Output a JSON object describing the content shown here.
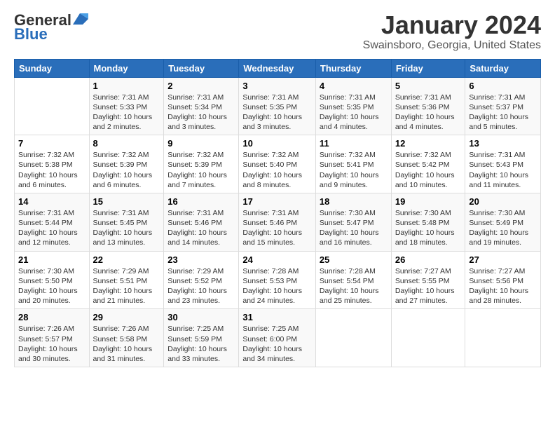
{
  "header": {
    "logo_line1": "General",
    "logo_line2": "Blue",
    "calendar_title": "January 2024",
    "calendar_subtitle": "Swainsboro, Georgia, United States"
  },
  "days_of_week": [
    "Sunday",
    "Monday",
    "Tuesday",
    "Wednesday",
    "Thursday",
    "Friday",
    "Saturday"
  ],
  "weeks": [
    [
      {
        "day": "",
        "info": ""
      },
      {
        "day": "1",
        "info": "Sunrise: 7:31 AM\nSunset: 5:33 PM\nDaylight: 10 hours\nand 2 minutes."
      },
      {
        "day": "2",
        "info": "Sunrise: 7:31 AM\nSunset: 5:34 PM\nDaylight: 10 hours\nand 3 minutes."
      },
      {
        "day": "3",
        "info": "Sunrise: 7:31 AM\nSunset: 5:35 PM\nDaylight: 10 hours\nand 3 minutes."
      },
      {
        "day": "4",
        "info": "Sunrise: 7:31 AM\nSunset: 5:35 PM\nDaylight: 10 hours\nand 4 minutes."
      },
      {
        "day": "5",
        "info": "Sunrise: 7:31 AM\nSunset: 5:36 PM\nDaylight: 10 hours\nand 4 minutes."
      },
      {
        "day": "6",
        "info": "Sunrise: 7:31 AM\nSunset: 5:37 PM\nDaylight: 10 hours\nand 5 minutes."
      }
    ],
    [
      {
        "day": "7",
        "info": "Sunrise: 7:32 AM\nSunset: 5:38 PM\nDaylight: 10 hours\nand 6 minutes."
      },
      {
        "day": "8",
        "info": "Sunrise: 7:32 AM\nSunset: 5:39 PM\nDaylight: 10 hours\nand 6 minutes."
      },
      {
        "day": "9",
        "info": "Sunrise: 7:32 AM\nSunset: 5:39 PM\nDaylight: 10 hours\nand 7 minutes."
      },
      {
        "day": "10",
        "info": "Sunrise: 7:32 AM\nSunset: 5:40 PM\nDaylight: 10 hours\nand 8 minutes."
      },
      {
        "day": "11",
        "info": "Sunrise: 7:32 AM\nSunset: 5:41 PM\nDaylight: 10 hours\nand 9 minutes."
      },
      {
        "day": "12",
        "info": "Sunrise: 7:32 AM\nSunset: 5:42 PM\nDaylight: 10 hours\nand 10 minutes."
      },
      {
        "day": "13",
        "info": "Sunrise: 7:31 AM\nSunset: 5:43 PM\nDaylight: 10 hours\nand 11 minutes."
      }
    ],
    [
      {
        "day": "14",
        "info": "Sunrise: 7:31 AM\nSunset: 5:44 PM\nDaylight: 10 hours\nand 12 minutes."
      },
      {
        "day": "15",
        "info": "Sunrise: 7:31 AM\nSunset: 5:45 PM\nDaylight: 10 hours\nand 13 minutes."
      },
      {
        "day": "16",
        "info": "Sunrise: 7:31 AM\nSunset: 5:46 PM\nDaylight: 10 hours\nand 14 minutes."
      },
      {
        "day": "17",
        "info": "Sunrise: 7:31 AM\nSunset: 5:46 PM\nDaylight: 10 hours\nand 15 minutes."
      },
      {
        "day": "18",
        "info": "Sunrise: 7:30 AM\nSunset: 5:47 PM\nDaylight: 10 hours\nand 16 minutes."
      },
      {
        "day": "19",
        "info": "Sunrise: 7:30 AM\nSunset: 5:48 PM\nDaylight: 10 hours\nand 18 minutes."
      },
      {
        "day": "20",
        "info": "Sunrise: 7:30 AM\nSunset: 5:49 PM\nDaylight: 10 hours\nand 19 minutes."
      }
    ],
    [
      {
        "day": "21",
        "info": "Sunrise: 7:30 AM\nSunset: 5:50 PM\nDaylight: 10 hours\nand 20 minutes."
      },
      {
        "day": "22",
        "info": "Sunrise: 7:29 AM\nSunset: 5:51 PM\nDaylight: 10 hours\nand 21 minutes."
      },
      {
        "day": "23",
        "info": "Sunrise: 7:29 AM\nSunset: 5:52 PM\nDaylight: 10 hours\nand 23 minutes."
      },
      {
        "day": "24",
        "info": "Sunrise: 7:28 AM\nSunset: 5:53 PM\nDaylight: 10 hours\nand 24 minutes."
      },
      {
        "day": "25",
        "info": "Sunrise: 7:28 AM\nSunset: 5:54 PM\nDaylight: 10 hours\nand 25 minutes."
      },
      {
        "day": "26",
        "info": "Sunrise: 7:27 AM\nSunset: 5:55 PM\nDaylight: 10 hours\nand 27 minutes."
      },
      {
        "day": "27",
        "info": "Sunrise: 7:27 AM\nSunset: 5:56 PM\nDaylight: 10 hours\nand 28 minutes."
      }
    ],
    [
      {
        "day": "28",
        "info": "Sunrise: 7:26 AM\nSunset: 5:57 PM\nDaylight: 10 hours\nand 30 minutes."
      },
      {
        "day": "29",
        "info": "Sunrise: 7:26 AM\nSunset: 5:58 PM\nDaylight: 10 hours\nand 31 minutes."
      },
      {
        "day": "30",
        "info": "Sunrise: 7:25 AM\nSunset: 5:59 PM\nDaylight: 10 hours\nand 33 minutes."
      },
      {
        "day": "31",
        "info": "Sunrise: 7:25 AM\nSunset: 6:00 PM\nDaylight: 10 hours\nand 34 minutes."
      },
      {
        "day": "",
        "info": ""
      },
      {
        "day": "",
        "info": ""
      },
      {
        "day": "",
        "info": ""
      }
    ]
  ]
}
